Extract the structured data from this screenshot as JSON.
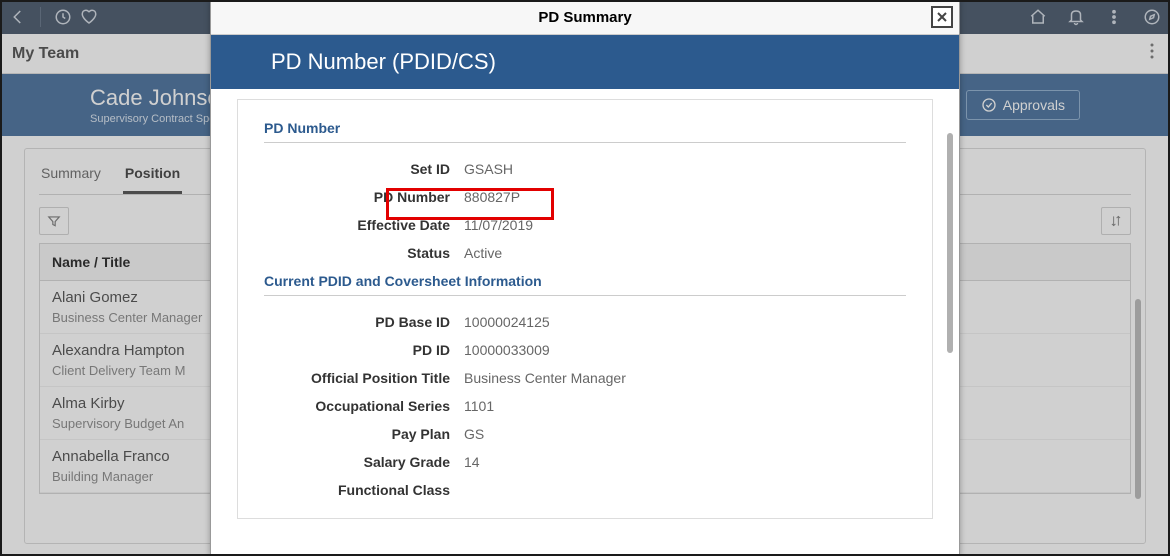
{
  "topnav": {},
  "myteam": {
    "title": "My Team"
  },
  "header": {
    "person_name": "Cade Johnson",
    "person_title": "Supervisory Contract Specialist",
    "approvals": "Approvals"
  },
  "tabs": {
    "summary": "Summary",
    "position": "Position"
  },
  "table": {
    "header": "Name / Title",
    "rows": [
      {
        "name": "Alani Gomez",
        "title": "Business Center Manager"
      },
      {
        "name": "Alexandra Hampton",
        "title": "Client Delivery Team M"
      },
      {
        "name": "Alma Kirby",
        "title": "Supervisory Budget An"
      },
      {
        "name": "Annabella Franco",
        "title": "Building Manager"
      }
    ]
  },
  "modal": {
    "title": "PD Summary",
    "subtitle": "PD Number (PDID/CS)",
    "section1": "PD Number",
    "section2": "Current PDID and Coversheet Information",
    "fields": {
      "set_id": {
        "label": "Set ID",
        "value": "GSASH"
      },
      "pd_number": {
        "label": "PD Number",
        "value": "880827P"
      },
      "effective_date": {
        "label": "Effective Date",
        "value": "11/07/2019"
      },
      "status": {
        "label": "Status",
        "value": "Active"
      },
      "pd_base_id": {
        "label": "PD Base ID",
        "value": "10000024125"
      },
      "pd_id": {
        "label": "PD ID",
        "value": "10000033009"
      },
      "official_title": {
        "label": "Official Position Title",
        "value": "Business Center Manager"
      },
      "occ_series": {
        "label": "Occupational Series",
        "value": "1101"
      },
      "pay_plan": {
        "label": "Pay Plan",
        "value": "GS"
      },
      "salary_grade": {
        "label": "Salary Grade",
        "value": "14"
      },
      "functional_class": {
        "label": "Functional Class",
        "value": ""
      }
    }
  }
}
